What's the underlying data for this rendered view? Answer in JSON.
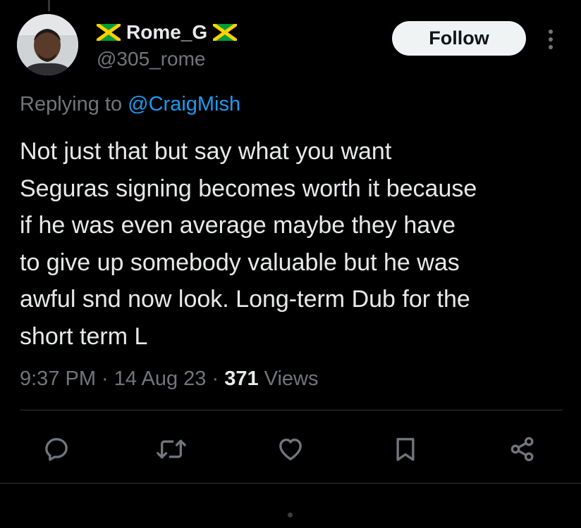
{
  "author": {
    "name": "Rome_G",
    "handle": "@305_rome",
    "flag_icon": "jamaica-flag-icon"
  },
  "header": {
    "follow_label": "Follow",
    "more_icon": "more-vertical-icon"
  },
  "reply_context": {
    "prefix": "Replying to ",
    "mention": "@CraigMish"
  },
  "tweet": {
    "text": "Not just that but say what you want\nSeguras signing becomes worth it because\nif he was even average maybe they have\nto give up somebody valuable but he was\nawful snd now look. Long-term Dub for the\nshort term L"
  },
  "meta": {
    "time": "9:37 PM",
    "separator": " · ",
    "date": "14 Aug 23",
    "views_count": "371",
    "views_label": " Views"
  },
  "actions": {
    "reply_icon": "reply-icon",
    "retweet_icon": "retweet-icon",
    "like_icon": "heart-icon",
    "bookmark_icon": "bookmark-icon",
    "share_icon": "share-icon"
  },
  "colors": {
    "background": "#000000",
    "text_primary": "#e7e9ea",
    "text_secondary": "#71767b",
    "link": "#1d9bf0",
    "divider": "#2f3336",
    "follow_bg": "#eff3f4",
    "flag_green": "#009b3a",
    "flag_gold": "#fed100"
  }
}
